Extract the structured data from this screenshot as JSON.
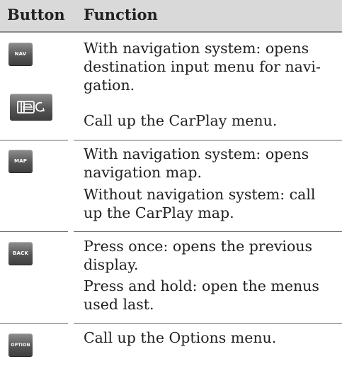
{
  "header": {
    "button": "Button",
    "function": "Function"
  },
  "rows": [
    {
      "key_label": "NAV",
      "text_1": "With navigation system: opens destination input menu for navi-gation.",
      "key2_icon": "carplay-icon",
      "text_2": "Call up the CarPlay menu."
    },
    {
      "key_label": "MAP",
      "text_1": "With navigation system: opens navigation map.",
      "text_2": "Without navigation system: call up the CarPlay map."
    },
    {
      "key_label": "BACK",
      "text_1": "Press once: opens the previous display.",
      "text_2": "Press and hold: open the menus used last."
    },
    {
      "key_label": "OPTION",
      "text_1": "Call up the Options menu."
    }
  ],
  "colors": {
    "header_bg": "#d9d9d9",
    "rule": "#666666",
    "key_dark": "#3e3e3e"
  }
}
